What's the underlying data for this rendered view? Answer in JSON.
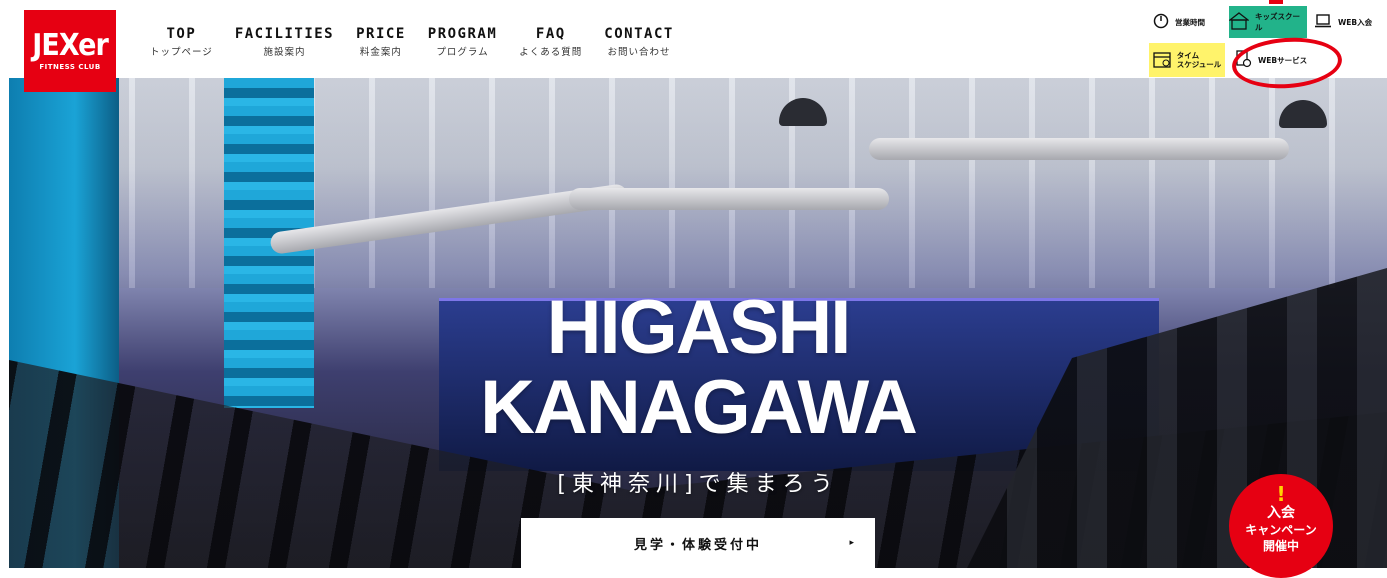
{
  "logo": {
    "mark": "JEXer",
    "sub": "FITNESS CLUB"
  },
  "nav": [
    {
      "en": "TOP",
      "jp": "トップページ"
    },
    {
      "en": "FACILITIES",
      "jp": "施設案内"
    },
    {
      "en": "PRICE",
      "jp": "料金案内"
    },
    {
      "en": "PROGRAM",
      "jp": "プログラム"
    },
    {
      "en": "FAQ",
      "jp": "よくある質問"
    },
    {
      "en": "CONTACT",
      "jp": "お問い合わせ"
    }
  ],
  "utility": {
    "hours": "営業時間",
    "kids": "キッズスクール",
    "web_join": "WEB入会",
    "time_schedule": "タイム\nスケジュール",
    "web_service": "WEBサービス"
  },
  "hero": {
    "title_line1": "HIGASHI",
    "title_line2": "KANAGAWA",
    "subtitle": "[東神奈川]で集まろう",
    "cta": "見学・体験受付中",
    "cta_arrow": "▸"
  },
  "campaign": {
    "mark": "!",
    "line1": "入会",
    "line2": "キャンペーン",
    "line3": "開催中"
  },
  "colors": {
    "brand_red": "#e60012",
    "kids_green": "#22b38a",
    "schedule_yellow": "#fff36b"
  }
}
